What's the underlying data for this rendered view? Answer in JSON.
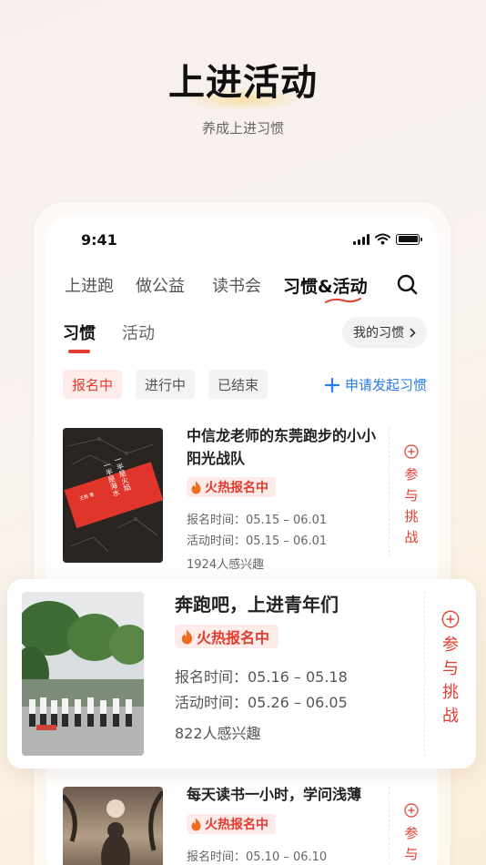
{
  "hero": {
    "title": "上进活动",
    "subtitle": "养成上进习惯"
  },
  "status_bar": {
    "time": "9:41"
  },
  "top_nav": {
    "tabs": [
      {
        "label": "上进跑"
      },
      {
        "label": "做公益"
      },
      {
        "label": "读书会"
      },
      {
        "label": "习惯&活动",
        "active": true
      }
    ]
  },
  "sub_tabs": {
    "tabs": [
      {
        "label": "习惯",
        "active": true
      },
      {
        "label": "活动"
      }
    ],
    "my_habits": "我的习惯"
  },
  "filters": {
    "chips": [
      {
        "label": "报名中",
        "active": true
      },
      {
        "label": "进行中"
      },
      {
        "label": "已结束"
      }
    ],
    "apply_label": "申请发起习惯"
  },
  "colors": {
    "accent": "#e23c2f",
    "link": "#2a7be4"
  },
  "cards": [
    {
      "title": "中信龙老师的东莞跑步的小小阳光战队",
      "badge": "火热报名中",
      "signup": "报名时间：05.15 – 06.01",
      "activity": "活动时间：05.15 – 06.01",
      "interest": "1924人感兴趣",
      "join_label": "参与挑战",
      "cover_text": {
        "line1": "一半是火焰",
        "line2": "一半是海水",
        "author": "王朔 著"
      }
    },
    {
      "title": "奔跑吧，上进青年们",
      "badge": "火热报名中",
      "signup": "报名时间：05.16 – 05.18",
      "activity": "活动时间：05.26 – 06.05",
      "interest": "822人感兴趣",
      "join_label": "参与挑战"
    },
    {
      "title": "每天读书一小时，学问浅薄",
      "badge": "火热报名中",
      "signup": "报名时间：05.10 – 06.10",
      "join_label": "参与"
    }
  ]
}
